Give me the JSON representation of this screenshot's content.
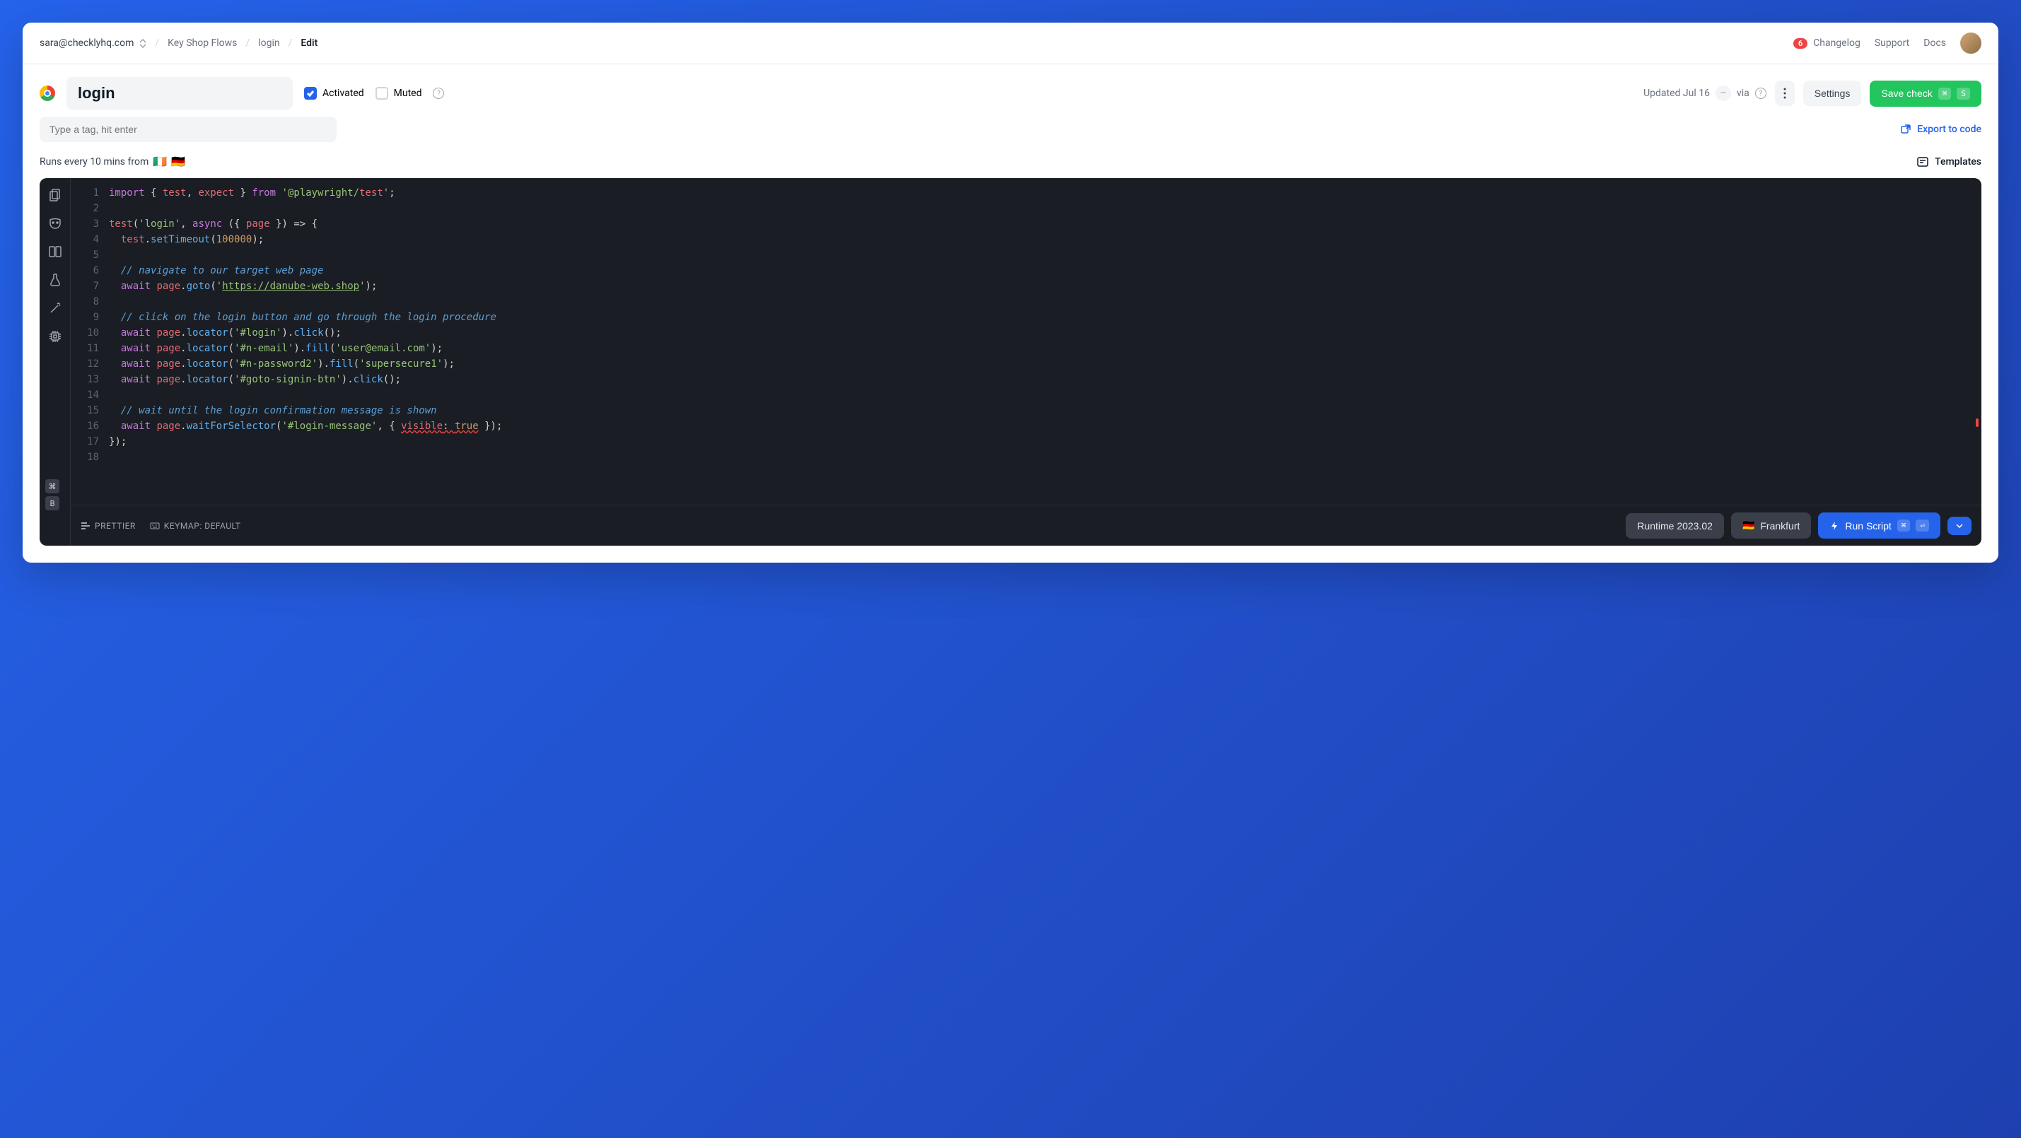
{
  "topbar": {
    "account": "sara@checklyhq.com",
    "crumb_group": "Key Shop Flows",
    "crumb_check": "login",
    "crumb_page": "Edit",
    "changelog_badge": "6",
    "changelog_label": "Changelog",
    "support_label": "Support",
    "docs_label": "Docs"
  },
  "header": {
    "title": "login",
    "activated_label": "Activated",
    "muted_label": "Muted",
    "updated_label": "Updated Jul 16",
    "via_label": "via",
    "settings_label": "Settings",
    "save_label": "Save check",
    "save_kbd1": "⌘",
    "save_kbd2": "S"
  },
  "subheader": {
    "tag_placeholder": "Type a tag, hit enter",
    "export_label": "Export to code"
  },
  "inforow": {
    "runs_label": "Runs every 10 mins from",
    "templates_label": "Templates"
  },
  "editor": {
    "lines": [
      "import { test, expect } from '@playwright/test';",
      "",
      "test('login', async ({ page }) => {",
      "  test.setTimeout(100000);",
      "",
      "  // navigate to our target web page",
      "  await page.goto('https://danube-web.shop');",
      "",
      "  // click on the login button and go through the login procedure",
      "  await page.locator('#login').click();",
      "  await page.locator('#n-email').fill('user@email.com');",
      "  await page.locator('#n-password2').fill('supersecure1');",
      "  await page.locator('#goto-signin-btn').click();",
      "",
      "  // wait until the login confirmation message is shown",
      "  await page.waitForSelector('#login-message', { visible: true });",
      "});",
      ""
    ],
    "badge1": "⌘",
    "badge2": "B"
  },
  "footer": {
    "prettier_label": "PRETTIER",
    "keymap_label": "KEYMAP: DEFAULT",
    "runtime_label": "Runtime 2023.02",
    "location_label": "Frankfurt",
    "run_label": "Run Script",
    "run_kbd1": "⌘",
    "run_kbd2": "⏎"
  }
}
